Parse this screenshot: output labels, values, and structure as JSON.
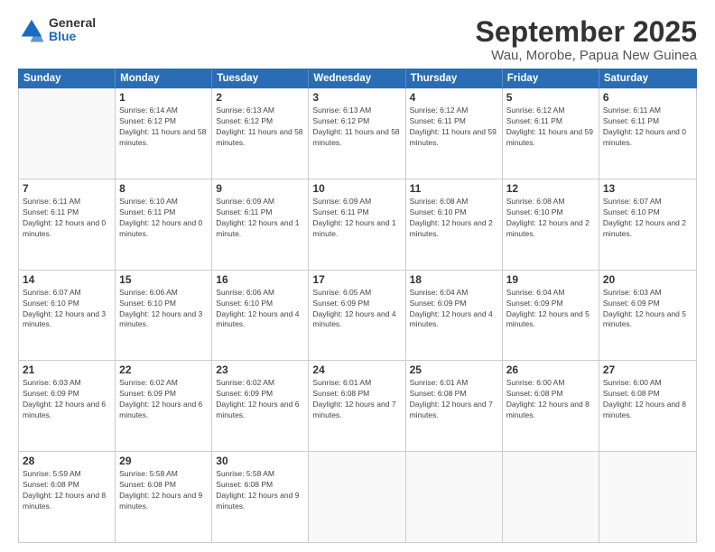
{
  "header": {
    "logo_line1": "General",
    "logo_line2": "Blue",
    "title": "September 2025",
    "subtitle": "Wau, Morobe, Papua New Guinea"
  },
  "days_of_week": [
    "Sunday",
    "Monday",
    "Tuesday",
    "Wednesday",
    "Thursday",
    "Friday",
    "Saturday"
  ],
  "weeks": [
    [
      {
        "day": "",
        "empty": true
      },
      {
        "day": "1",
        "sunrise": "6:14 AM",
        "sunset": "6:12 PM",
        "daylight": "11 hours and 58 minutes."
      },
      {
        "day": "2",
        "sunrise": "6:13 AM",
        "sunset": "6:12 PM",
        "daylight": "11 hours and 58 minutes."
      },
      {
        "day": "3",
        "sunrise": "6:13 AM",
        "sunset": "6:12 PM",
        "daylight": "11 hours and 58 minutes."
      },
      {
        "day": "4",
        "sunrise": "6:12 AM",
        "sunset": "6:11 PM",
        "daylight": "11 hours and 59 minutes."
      },
      {
        "day": "5",
        "sunrise": "6:12 AM",
        "sunset": "6:11 PM",
        "daylight": "11 hours and 59 minutes."
      },
      {
        "day": "6",
        "sunrise": "6:11 AM",
        "sunset": "6:11 PM",
        "daylight": "12 hours and 0 minutes."
      }
    ],
    [
      {
        "day": "7",
        "sunrise": "6:11 AM",
        "sunset": "6:11 PM",
        "daylight": "12 hours and 0 minutes."
      },
      {
        "day": "8",
        "sunrise": "6:10 AM",
        "sunset": "6:11 PM",
        "daylight": "12 hours and 0 minutes."
      },
      {
        "day": "9",
        "sunrise": "6:09 AM",
        "sunset": "6:11 PM",
        "daylight": "12 hours and 1 minute."
      },
      {
        "day": "10",
        "sunrise": "6:09 AM",
        "sunset": "6:11 PM",
        "daylight": "12 hours and 1 minute."
      },
      {
        "day": "11",
        "sunrise": "6:08 AM",
        "sunset": "6:10 PM",
        "daylight": "12 hours and 2 minutes."
      },
      {
        "day": "12",
        "sunrise": "6:08 AM",
        "sunset": "6:10 PM",
        "daylight": "12 hours and 2 minutes."
      },
      {
        "day": "13",
        "sunrise": "6:07 AM",
        "sunset": "6:10 PM",
        "daylight": "12 hours and 2 minutes."
      }
    ],
    [
      {
        "day": "14",
        "sunrise": "6:07 AM",
        "sunset": "6:10 PM",
        "daylight": "12 hours and 3 minutes."
      },
      {
        "day": "15",
        "sunrise": "6:06 AM",
        "sunset": "6:10 PM",
        "daylight": "12 hours and 3 minutes."
      },
      {
        "day": "16",
        "sunrise": "6:06 AM",
        "sunset": "6:10 PM",
        "daylight": "12 hours and 4 minutes."
      },
      {
        "day": "17",
        "sunrise": "6:05 AM",
        "sunset": "6:09 PM",
        "daylight": "12 hours and 4 minutes."
      },
      {
        "day": "18",
        "sunrise": "6:04 AM",
        "sunset": "6:09 PM",
        "daylight": "12 hours and 4 minutes."
      },
      {
        "day": "19",
        "sunrise": "6:04 AM",
        "sunset": "6:09 PM",
        "daylight": "12 hours and 5 minutes."
      },
      {
        "day": "20",
        "sunrise": "6:03 AM",
        "sunset": "6:09 PM",
        "daylight": "12 hours and 5 minutes."
      }
    ],
    [
      {
        "day": "21",
        "sunrise": "6:03 AM",
        "sunset": "6:09 PM",
        "daylight": "12 hours and 6 minutes."
      },
      {
        "day": "22",
        "sunrise": "6:02 AM",
        "sunset": "6:09 PM",
        "daylight": "12 hours and 6 minutes."
      },
      {
        "day": "23",
        "sunrise": "6:02 AM",
        "sunset": "6:09 PM",
        "daylight": "12 hours and 6 minutes."
      },
      {
        "day": "24",
        "sunrise": "6:01 AM",
        "sunset": "6:08 PM",
        "daylight": "12 hours and 7 minutes."
      },
      {
        "day": "25",
        "sunrise": "6:01 AM",
        "sunset": "6:08 PM",
        "daylight": "12 hours and 7 minutes."
      },
      {
        "day": "26",
        "sunrise": "6:00 AM",
        "sunset": "6:08 PM",
        "daylight": "12 hours and 8 minutes."
      },
      {
        "day": "27",
        "sunrise": "6:00 AM",
        "sunset": "6:08 PM",
        "daylight": "12 hours and 8 minutes."
      }
    ],
    [
      {
        "day": "28",
        "sunrise": "5:59 AM",
        "sunset": "6:08 PM",
        "daylight": "12 hours and 8 minutes."
      },
      {
        "day": "29",
        "sunrise": "5:58 AM",
        "sunset": "6:08 PM",
        "daylight": "12 hours and 9 minutes."
      },
      {
        "day": "30",
        "sunrise": "5:58 AM",
        "sunset": "6:08 PM",
        "daylight": "12 hours and 9 minutes."
      },
      {
        "day": "",
        "empty": true
      },
      {
        "day": "",
        "empty": true
      },
      {
        "day": "",
        "empty": true
      },
      {
        "day": "",
        "empty": true
      }
    ]
  ]
}
